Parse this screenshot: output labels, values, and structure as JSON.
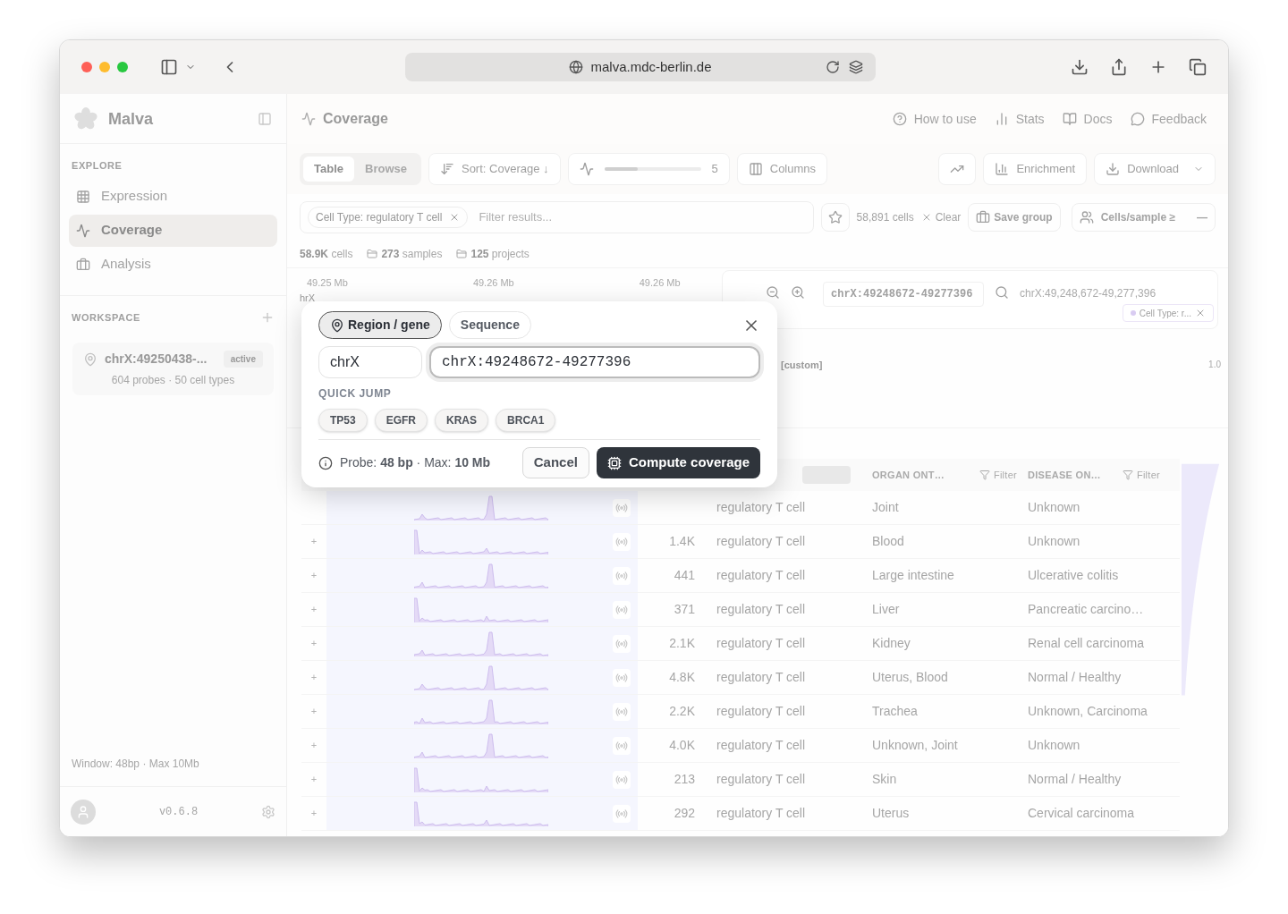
{
  "browser": {
    "url": "malva.mdc-berlin.de"
  },
  "sidebar": {
    "app_name": "Malva",
    "section": "EXPLORE",
    "items": [
      {
        "label": "Expression",
        "selected": false
      },
      {
        "label": "Coverage",
        "selected": true
      },
      {
        "label": "Analysis",
        "selected": false
      }
    ],
    "workspace": {
      "heading": "WORKSPACE",
      "items": [
        {
          "title": "chrX:49250438-...",
          "badge": "active",
          "subtitle": "604 probes · 50 cell types"
        }
      ]
    },
    "footer_note": "Window: 48bp · Max 10Mb",
    "version": "v0.6.8"
  },
  "page": {
    "title": "Coverage",
    "links": [
      "How to use",
      "Stats",
      "Docs",
      "Feedback"
    ]
  },
  "toolbar": {
    "view_tabs": [
      {
        "label": "Table",
        "selected": true
      },
      {
        "label": "Browse",
        "selected": false
      }
    ],
    "sort": "Sort: Coverage ↓",
    "slider": {
      "level": 0.35,
      "reading": "5"
    },
    "columns": "Columns",
    "enrichment": "Enrichment",
    "download": "Download"
  },
  "filter_bar": {
    "chip": "Cell Type: regulatory T cell",
    "placeholder": "Filter results...",
    "count": "58,891 cells",
    "clear": "Clear",
    "save_group": "Save group",
    "cells_per_sample": "Cells/sample ≥",
    "cells_per_sample_value": "—"
  },
  "stats": [
    {
      "value": "58.9K",
      "label": "cells"
    },
    {
      "value": "273",
      "label": "samples"
    },
    {
      "value": "125",
      "label": "projects"
    }
  ],
  "browse": {
    "axis_ticks": [
      "49.25 Mb",
      "49.26 Mb",
      "49.26 Mb"
    ],
    "track_label": "hrX",
    "locus": "chrX:49248672-49277396",
    "coordinates": "chrX:49,248,672-49,277,396",
    "chip": "Cell Type: r...",
    "custom_label": "[custom]",
    "scale_max": "1.0"
  },
  "table": {
    "columns": [
      {
        "label": "ORGAN ONT…",
        "filter": "Filter"
      },
      {
        "label": "DISEASE ON…",
        "filter": "Filter"
      }
    ],
    "rows": [
      {
        "cell_type": "regulatory T cell",
        "organ": "Joint",
        "disease": "Unknown"
      },
      {
        "expand": "+",
        "count": "1.4K",
        "cell_type": "regulatory T cell",
        "organ": "Blood",
        "disease": "Unknown"
      },
      {
        "expand": "+",
        "count": "441",
        "cell_type": "regulatory T cell",
        "organ": "Large intestine",
        "disease": "Ulcerative colitis"
      },
      {
        "expand": "+",
        "count": "371",
        "cell_type": "regulatory T cell",
        "organ": "Liver",
        "disease": "Pancreatic carcino…"
      },
      {
        "expand": "+",
        "count": "2.1K",
        "cell_type": "regulatory T cell",
        "organ": "Kidney",
        "disease": "Renal cell carcinoma"
      },
      {
        "expand": "+",
        "count": "4.8K",
        "cell_type": "regulatory T cell",
        "organ": "Uterus, Blood",
        "disease": "Normal / Healthy"
      },
      {
        "expand": "+",
        "count": "2.2K",
        "cell_type": "regulatory T cell",
        "organ": "Trachea",
        "disease": "Unknown, Carcinoma"
      },
      {
        "expand": "+",
        "count": "4.0K",
        "cell_type": "regulatory T cell",
        "organ": "Unknown, Joint",
        "disease": "Unknown"
      },
      {
        "expand": "+",
        "count": "213",
        "cell_type": "regulatory T cell",
        "organ": "Skin",
        "disease": "Normal / Healthy"
      },
      {
        "expand": "+",
        "count": "292",
        "cell_type": "regulatory T cell",
        "organ": "Uterus",
        "disease": "Cervical carcinoma"
      }
    ]
  },
  "modal": {
    "tabs": [
      {
        "label": "Region / gene",
        "selected": true
      },
      {
        "label": "Sequence",
        "selected": false
      }
    ],
    "chromosome": "chrX",
    "region": "chrX:49248672-49277396",
    "quick_jump_label": "QUICK JUMP",
    "quick_jump": [
      "TP53",
      "EGFR",
      "KRAS",
      "BRCA1"
    ],
    "info": "Probe: **48 bp** · Max: **10 Mb**",
    "cancel": "Cancel",
    "submit": "Compute coverage"
  }
}
